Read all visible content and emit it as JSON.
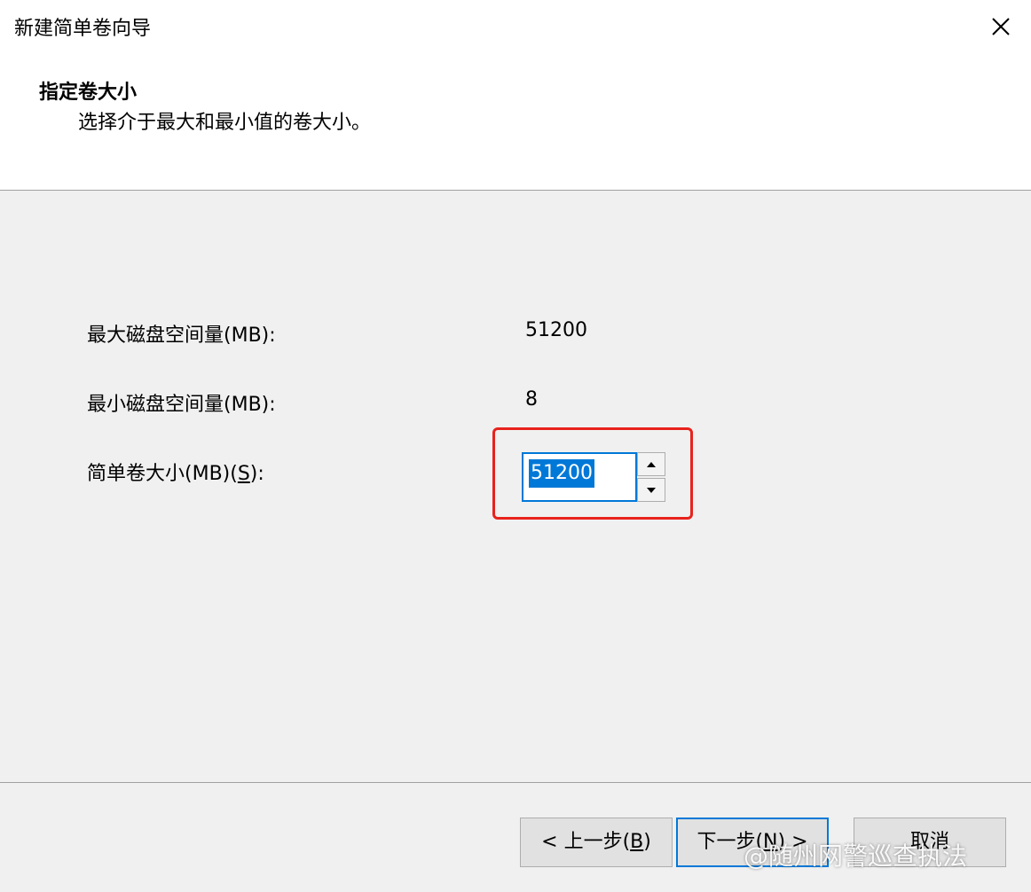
{
  "window": {
    "title": "新建简单卷向导"
  },
  "header": {
    "title": "指定卷大小",
    "subtitle": "选择介于最大和最小值的卷大小。"
  },
  "fields": {
    "max_label": "最大磁盘空间量(MB):",
    "max_value": "51200",
    "min_label": "最小磁盘空间量(MB):",
    "min_value": "8",
    "size_label_prefix": "简单卷大小(MB)(",
    "size_label_key": "S",
    "size_label_suffix": "):",
    "size_value": "51200"
  },
  "buttons": {
    "back_prefix": "< 上一步(",
    "back_key": "B",
    "back_suffix": ")",
    "next_prefix": "下一步(",
    "next_key": "N",
    "next_suffix": ") >",
    "cancel": "取消"
  },
  "watermark": "@随州网警巡查执法",
  "colors": {
    "accent": "#0078d7",
    "highlight": "#e8221c",
    "dialog_bg": "#f0f0f0",
    "header_bg": "#ffffff"
  },
  "icons": {
    "close": "close-icon",
    "spin_up": "chevron-up-icon",
    "spin_down": "chevron-down-icon"
  }
}
